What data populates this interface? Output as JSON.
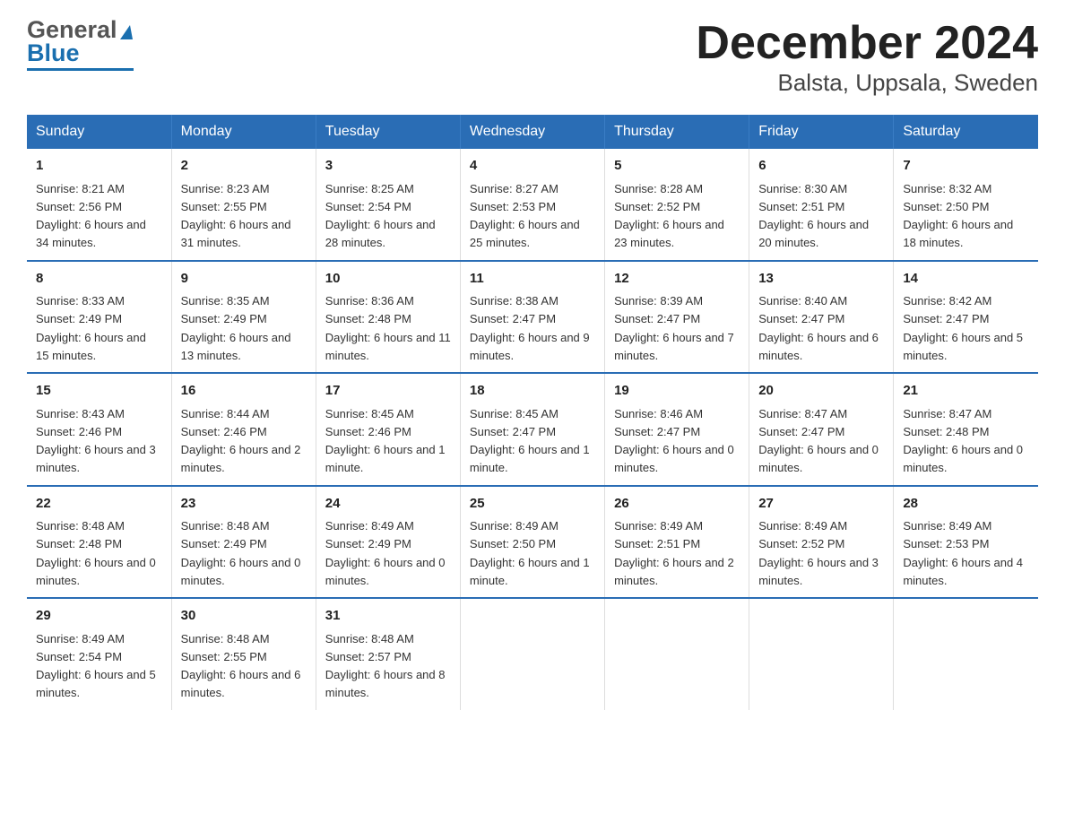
{
  "header": {
    "title": "December 2024",
    "subtitle": "Balsta, Uppsala, Sweden",
    "logo_general": "General",
    "logo_blue": "Blue"
  },
  "days_header": [
    "Sunday",
    "Monday",
    "Tuesday",
    "Wednesday",
    "Thursday",
    "Friday",
    "Saturday"
  ],
  "weeks": [
    [
      {
        "num": "1",
        "sunrise": "8:21 AM",
        "sunset": "2:56 PM",
        "daylight": "6 hours and 34 minutes."
      },
      {
        "num": "2",
        "sunrise": "8:23 AM",
        "sunset": "2:55 PM",
        "daylight": "6 hours and 31 minutes."
      },
      {
        "num": "3",
        "sunrise": "8:25 AM",
        "sunset": "2:54 PM",
        "daylight": "6 hours and 28 minutes."
      },
      {
        "num": "4",
        "sunrise": "8:27 AM",
        "sunset": "2:53 PM",
        "daylight": "6 hours and 25 minutes."
      },
      {
        "num": "5",
        "sunrise": "8:28 AM",
        "sunset": "2:52 PM",
        "daylight": "6 hours and 23 minutes."
      },
      {
        "num": "6",
        "sunrise": "8:30 AM",
        "sunset": "2:51 PM",
        "daylight": "6 hours and 20 minutes."
      },
      {
        "num": "7",
        "sunrise": "8:32 AM",
        "sunset": "2:50 PM",
        "daylight": "6 hours and 18 minutes."
      }
    ],
    [
      {
        "num": "8",
        "sunrise": "8:33 AM",
        "sunset": "2:49 PM",
        "daylight": "6 hours and 15 minutes."
      },
      {
        "num": "9",
        "sunrise": "8:35 AM",
        "sunset": "2:49 PM",
        "daylight": "6 hours and 13 minutes."
      },
      {
        "num": "10",
        "sunrise": "8:36 AM",
        "sunset": "2:48 PM",
        "daylight": "6 hours and 11 minutes."
      },
      {
        "num": "11",
        "sunrise": "8:38 AM",
        "sunset": "2:47 PM",
        "daylight": "6 hours and 9 minutes."
      },
      {
        "num": "12",
        "sunrise": "8:39 AM",
        "sunset": "2:47 PM",
        "daylight": "6 hours and 7 minutes."
      },
      {
        "num": "13",
        "sunrise": "8:40 AM",
        "sunset": "2:47 PM",
        "daylight": "6 hours and 6 minutes."
      },
      {
        "num": "14",
        "sunrise": "8:42 AM",
        "sunset": "2:47 PM",
        "daylight": "6 hours and 5 minutes."
      }
    ],
    [
      {
        "num": "15",
        "sunrise": "8:43 AM",
        "sunset": "2:46 PM",
        "daylight": "6 hours and 3 minutes."
      },
      {
        "num": "16",
        "sunrise": "8:44 AM",
        "sunset": "2:46 PM",
        "daylight": "6 hours and 2 minutes."
      },
      {
        "num": "17",
        "sunrise": "8:45 AM",
        "sunset": "2:46 PM",
        "daylight": "6 hours and 1 minute."
      },
      {
        "num": "18",
        "sunrise": "8:45 AM",
        "sunset": "2:47 PM",
        "daylight": "6 hours and 1 minute."
      },
      {
        "num": "19",
        "sunrise": "8:46 AM",
        "sunset": "2:47 PM",
        "daylight": "6 hours and 0 minutes."
      },
      {
        "num": "20",
        "sunrise": "8:47 AM",
        "sunset": "2:47 PM",
        "daylight": "6 hours and 0 minutes."
      },
      {
        "num": "21",
        "sunrise": "8:47 AM",
        "sunset": "2:48 PM",
        "daylight": "6 hours and 0 minutes."
      }
    ],
    [
      {
        "num": "22",
        "sunrise": "8:48 AM",
        "sunset": "2:48 PM",
        "daylight": "6 hours and 0 minutes."
      },
      {
        "num": "23",
        "sunrise": "8:48 AM",
        "sunset": "2:49 PM",
        "daylight": "6 hours and 0 minutes."
      },
      {
        "num": "24",
        "sunrise": "8:49 AM",
        "sunset": "2:49 PM",
        "daylight": "6 hours and 0 minutes."
      },
      {
        "num": "25",
        "sunrise": "8:49 AM",
        "sunset": "2:50 PM",
        "daylight": "6 hours and 1 minute."
      },
      {
        "num": "26",
        "sunrise": "8:49 AM",
        "sunset": "2:51 PM",
        "daylight": "6 hours and 2 minutes."
      },
      {
        "num": "27",
        "sunrise": "8:49 AM",
        "sunset": "2:52 PM",
        "daylight": "6 hours and 3 minutes."
      },
      {
        "num": "28",
        "sunrise": "8:49 AM",
        "sunset": "2:53 PM",
        "daylight": "6 hours and 4 minutes."
      }
    ],
    [
      {
        "num": "29",
        "sunrise": "8:49 AM",
        "sunset": "2:54 PM",
        "daylight": "6 hours and 5 minutes."
      },
      {
        "num": "30",
        "sunrise": "8:48 AM",
        "sunset": "2:55 PM",
        "daylight": "6 hours and 6 minutes."
      },
      {
        "num": "31",
        "sunrise": "8:48 AM",
        "sunset": "2:57 PM",
        "daylight": "6 hours and 8 minutes."
      },
      null,
      null,
      null,
      null
    ]
  ],
  "labels": {
    "sunrise": "Sunrise: ",
    "sunset": "Sunset: ",
    "daylight": "Daylight: "
  },
  "colors": {
    "header_bg": "#2a6db5",
    "header_text": "#ffffff",
    "border": "#2a6db5"
  }
}
